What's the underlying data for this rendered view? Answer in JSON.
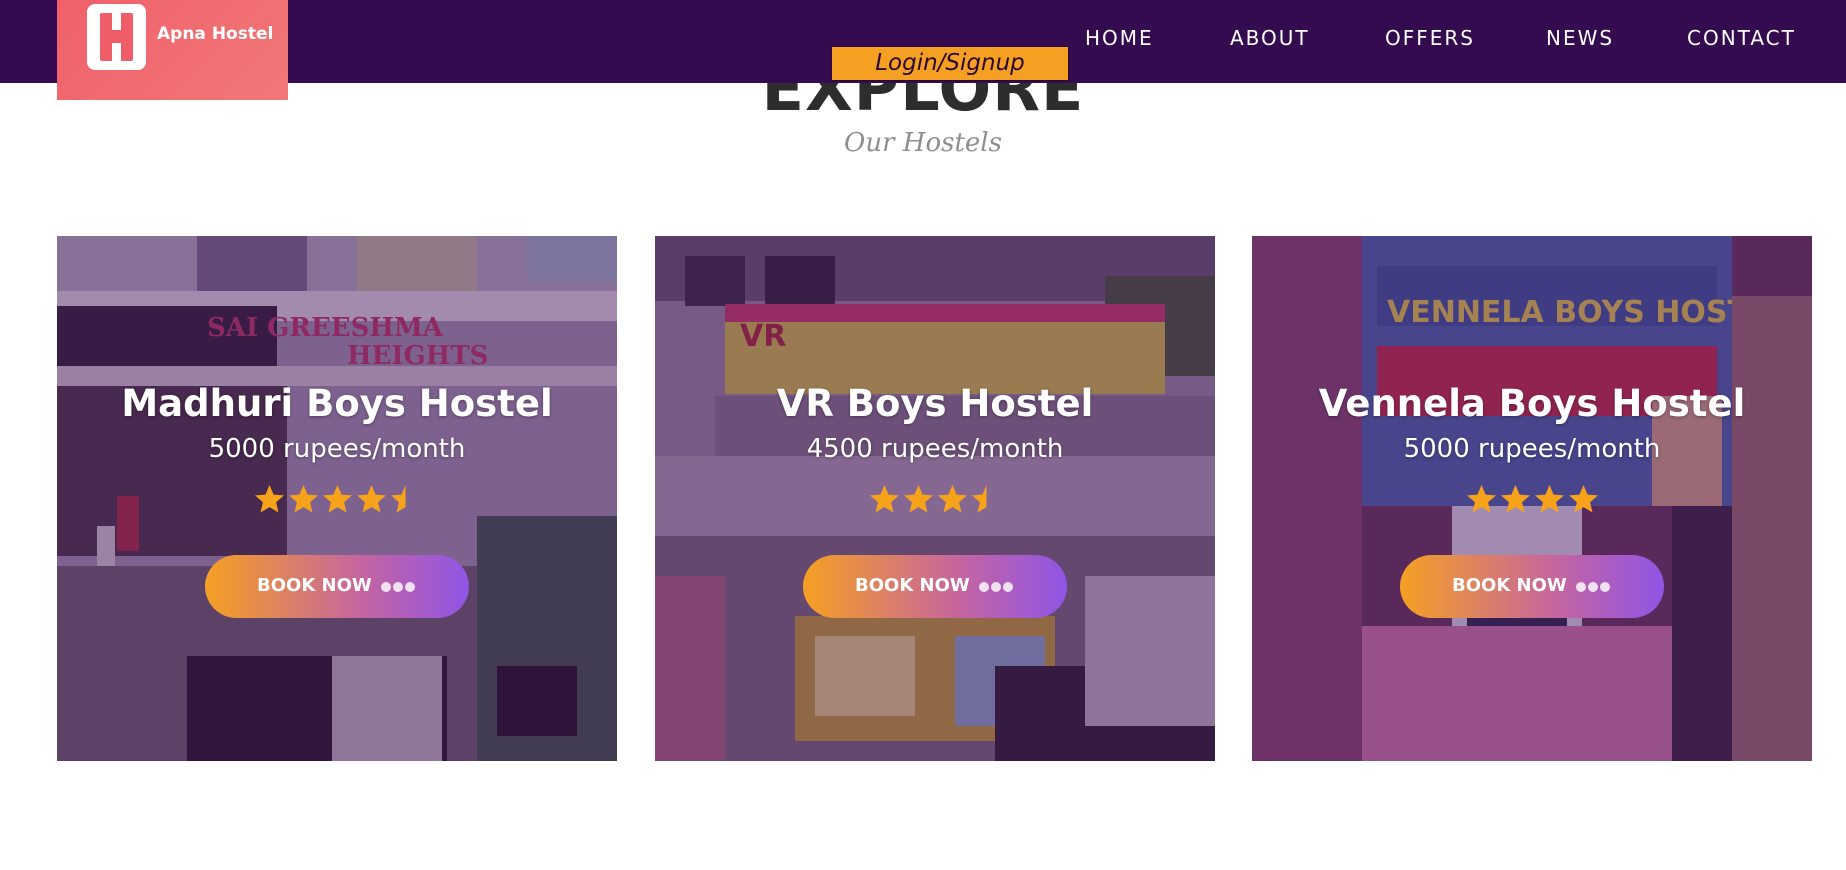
{
  "header": {
    "logo_text": "Apna Hostel",
    "login_label": "Login/Signup",
    "nav": {
      "home": "HOME",
      "about": "ABOUT",
      "offers": "OFFERS",
      "news": "NEWS",
      "contact": "CONTACT"
    }
  },
  "section": {
    "title": "EXPLORE",
    "subtitle": "Our Hostels"
  },
  "colors": {
    "navbar": "#350b50",
    "logo_bg": "#f06a70",
    "accent_orange": "#f5a023",
    "accent_purple": "#8f55e6",
    "star": "#f7a21b"
  },
  "hostels": [
    {
      "name": "Madhuri Boys Hostel",
      "price": "5000 rupees/month",
      "rating": 4.5,
      "book_label": "BOOK NOW",
      "sign_text": "SAI GREESHMA HEIGHTS"
    },
    {
      "name": "VR Boys Hostel",
      "price": "4500 rupees/month",
      "rating": 3.5,
      "book_label": "BOOK NOW",
      "sign_text": "VR"
    },
    {
      "name": "Vennela Boys Hostel",
      "price": "5000 rupees/month",
      "rating": 4,
      "book_label": "BOOK NOW",
      "sign_text": "VENNELA BOYS HOSTTEL"
    }
  ]
}
